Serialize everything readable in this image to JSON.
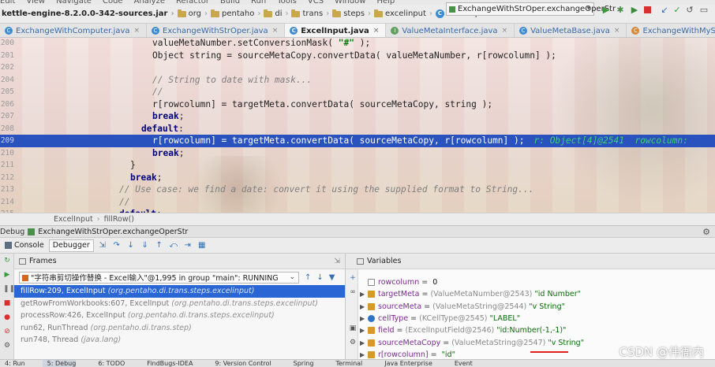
{
  "menubar": {
    "items": [
      "Edit",
      "View",
      "Navigate",
      "Code",
      "Analyze",
      "Refactor",
      "Build",
      "Run",
      "Tools",
      "VCS",
      "Window",
      "Help"
    ]
  },
  "navbar": {
    "crumbs": [
      "kettle-engine-8.2.0.0-342-sources.jar",
      "org",
      "pentaho",
      "di",
      "trans",
      "steps",
      "excelinput",
      "ExcelInput"
    ],
    "run_config": "ExchangeWithStrOper.exchangeOperStr"
  },
  "tabs": [
    {
      "label": "ExchangeWithComputer.java",
      "icon": "class-icon",
      "active": false
    },
    {
      "label": "ExchangeWithStrOper.java",
      "icon": "class-icon",
      "active": false
    },
    {
      "label": "ExcelInput.java",
      "icon": "class-icon",
      "active": true
    },
    {
      "label": "ValueMetaInterface.java",
      "icon": "interface-icon",
      "active": false
    },
    {
      "label": "ValueMetaBase.java",
      "icon": "class-icon",
      "active": false
    },
    {
      "label": "ExchangeWithMySQL.java",
      "icon": "file-icon",
      "active": false
    }
  ],
  "editor": {
    "lines": [
      {
        "n": "200",
        "code": "valueMetaNumber.setConversionMask( \"#\" );",
        "indent": 0
      },
      {
        "n": "201",
        "code": "Object string = sourceMetaCopy.convertData( valueMetaNumber, r[rowcolumn] );",
        "indent": 0
      },
      {
        "n": "202",
        "code": "",
        "indent": 0
      },
      {
        "n": "204",
        "code": "// String to date with mask...",
        "indent": 0
      },
      {
        "n": "205",
        "code": "//",
        "indent": 0
      },
      {
        "n": "206",
        "code": "r[rowcolumn] = targetMeta.convertData( sourceMetaCopy, string );",
        "indent": 0
      },
      {
        "n": "207",
        "code": "break;",
        "indent": 0
      },
      {
        "n": "208",
        "code": "default:",
        "indent": -1
      },
      {
        "n": "209",
        "code": "r[rowcolumn] = targetMeta.convertData( sourceMetaCopy, r[rowcolumn] );",
        "indent": 0,
        "inline": "r: Object[4]@2541  rowcolumn:"
      },
      {
        "n": "210",
        "code": "break;",
        "indent": 0
      },
      {
        "n": "211",
        "code": "}",
        "indent": -2
      },
      {
        "n": "212",
        "code": "break;",
        "indent": -2
      },
      {
        "n": "213",
        "code": "// Use case: we find a date: convert it using the supplied format to String...",
        "indent": -3
      },
      {
        "n": "214",
        "code": "//",
        "indent": -3
      },
      {
        "n": "215",
        "code": "default:",
        "indent": -3
      }
    ],
    "breadcrumb": [
      "ExcelInput",
      "fillRow()"
    ]
  },
  "debug": {
    "prefix": "Debug",
    "config": "ExchangeWithStrOper.exchangeOperStr",
    "tabs": [
      "Console",
      "Debugger"
    ]
  },
  "frames": {
    "title": "Frames",
    "thread": "\"字符串剪切操作替换 - Excel输入\"@1,995 in group \"main\": RUNNING",
    "items": [
      {
        "method": "fillRow:209, ExcelInput",
        "location": "(org.pentaho.di.trans.steps.excelinput)",
        "selected": true
      },
      {
        "method": "getRowFromWorkbooks:607, ExcelInput",
        "location": "(org.pentaho.di.trans.steps.excelinput)",
        "selected": false
      },
      {
        "method": "processRow:426, ExcelInput",
        "location": "(org.pentaho.di.trans.steps.excelinput)",
        "selected": false
      },
      {
        "method": "run62, RunThread",
        "location": "(org.pentaho.di.trans.step)",
        "selected": false
      },
      {
        "method": "run748, Thread",
        "location": "(java.lang)",
        "selected": false
      }
    ]
  },
  "variables": {
    "title": "Variables",
    "items": [
      {
        "name": "rowcolumn",
        "eq": "=",
        "type": "",
        "value": "0",
        "icon": "primitive",
        "expandable": false
      },
      {
        "name": "targetMeta",
        "eq": "=",
        "type": "(ValueMetaNumber@2543)",
        "value": "\"id Number\"",
        "icon": "field",
        "expandable": true
      },
      {
        "name": "sourceMeta",
        "eq": "=",
        "type": "(ValueMetaString@2544)",
        "value": "\"v String\"",
        "icon": "field",
        "expandable": true
      },
      {
        "name": "cellType",
        "eq": "=",
        "type": "(KCellType@2545)",
        "value": "\"LABEL\"",
        "icon": "info",
        "expandable": true
      },
      {
        "name": "field",
        "eq": "=",
        "type": "(ExcelInputField@2546)",
        "value": "\"id:Number(-1,-1)\"",
        "icon": "field",
        "expandable": true
      },
      {
        "name": "sourceMetaCopy",
        "eq": "=",
        "type": "(ValueMetaString@2547)",
        "value": "\"v String\"",
        "icon": "field",
        "expandable": true
      },
      {
        "name": "r[rowcolumn]",
        "eq": "=",
        "type": "",
        "value": "\"id\"",
        "icon": "field",
        "expandable": true
      }
    ]
  },
  "bottombar": {
    "tabs": [
      "4: Run",
      "5: Debug",
      "6: TODO",
      "FindBugs-IDEA",
      "9: Version Control",
      "Spring",
      "Terminal",
      "Java Enterprise",
      "Event"
    ]
  },
  "watermark": "CSDN @伟衙内"
}
